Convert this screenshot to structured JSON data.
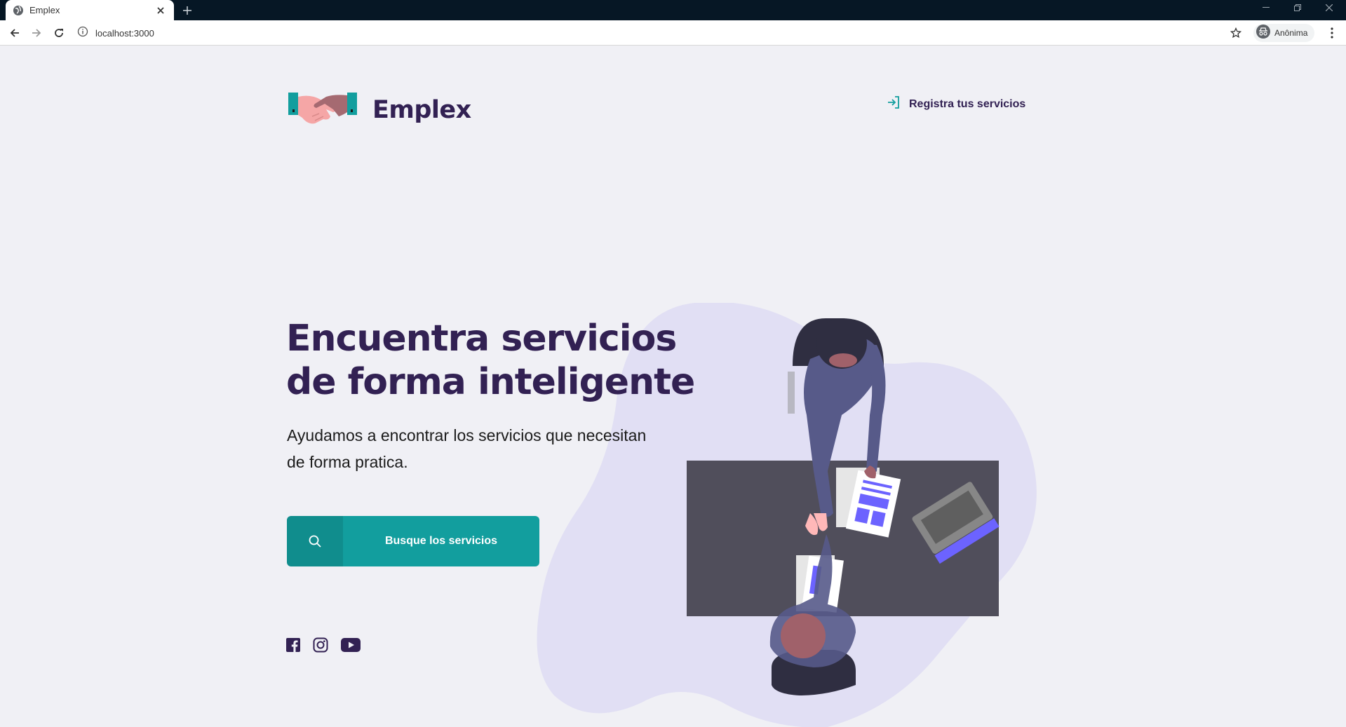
{
  "browser": {
    "tab_title": "Emplex",
    "url": "localhost:3000",
    "profile_label": "Anônima"
  },
  "header": {
    "brand": "Emplex",
    "register_link": "Registra tus servicios"
  },
  "hero": {
    "title_line1": "Encuentra servicios",
    "title_line2": "de forma inteligente",
    "subtitle_line1": "Ayudamos a encontrar los servicios que necesitan",
    "subtitle_line2": "de forma pratica.",
    "cta_label": "Busque los servicios"
  },
  "social": [
    "facebook-icon",
    "instagram-icon",
    "youtube-icon"
  ],
  "colors": {
    "brand_dark": "#322153",
    "accent": "#129e9e",
    "background": "#f0f0f5",
    "illustration_blob": "#e1dff4",
    "table": "#504e5b",
    "highlight": "#6c63ff"
  }
}
